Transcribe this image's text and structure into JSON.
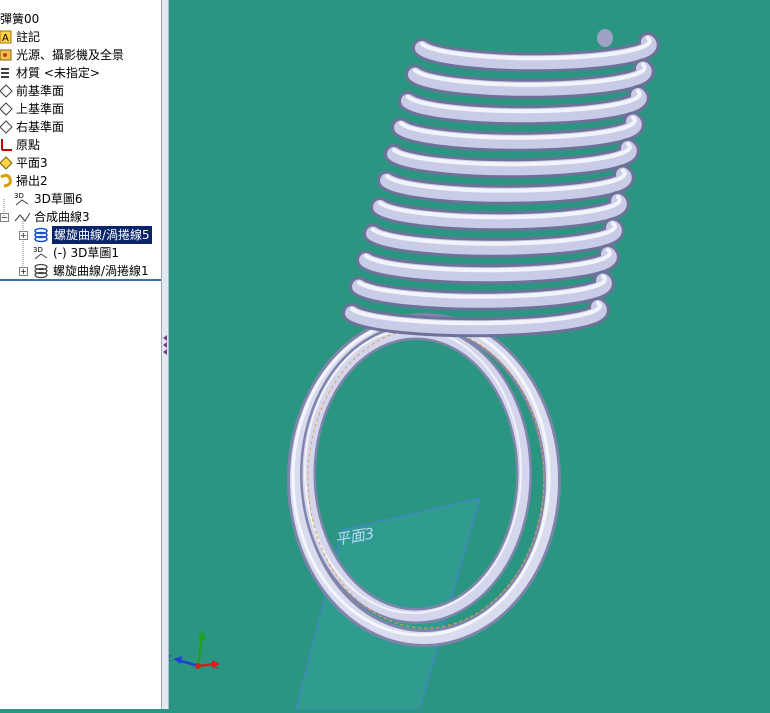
{
  "feature_tree": {
    "items": [
      {
        "label": "彈簧00",
        "icon": "part-icon"
      },
      {
        "label": "註記",
        "icon": "annotation-icon"
      },
      {
        "label": "光源、攝影機及全景",
        "icon": "lights-cameras-icon"
      },
      {
        "label": "材質 <未指定>",
        "icon": "material-icon"
      },
      {
        "label": "前基準面",
        "icon": "plane-icon"
      },
      {
        "label": "上基準面",
        "icon": "plane-icon"
      },
      {
        "label": "右基準面",
        "icon": "plane-icon"
      },
      {
        "label": "原點",
        "icon": "origin-icon"
      },
      {
        "label": "平面3",
        "icon": "plane-icon"
      },
      {
        "label": "掃出2",
        "icon": "sweep-icon"
      },
      {
        "label": "3D草圖6",
        "icon": "3d-sketch-icon"
      },
      {
        "label": "合成曲線3",
        "icon": "composite-curve-icon"
      },
      {
        "label": "螺旋曲線/渦捲線5",
        "icon": "helix-icon",
        "selected": true
      },
      {
        "label": "(-) 3D草圖1",
        "icon": "3d-sketch-icon"
      },
      {
        "label": "螺旋曲線/渦捲線1",
        "icon": "helix-icon"
      }
    ]
  },
  "viewport": {
    "plane_label": "平面3",
    "background_color": "#2a9681",
    "spring_color": "#c9cde6",
    "triad": {
      "x": "X",
      "y": "Y",
      "z": "Z"
    }
  }
}
